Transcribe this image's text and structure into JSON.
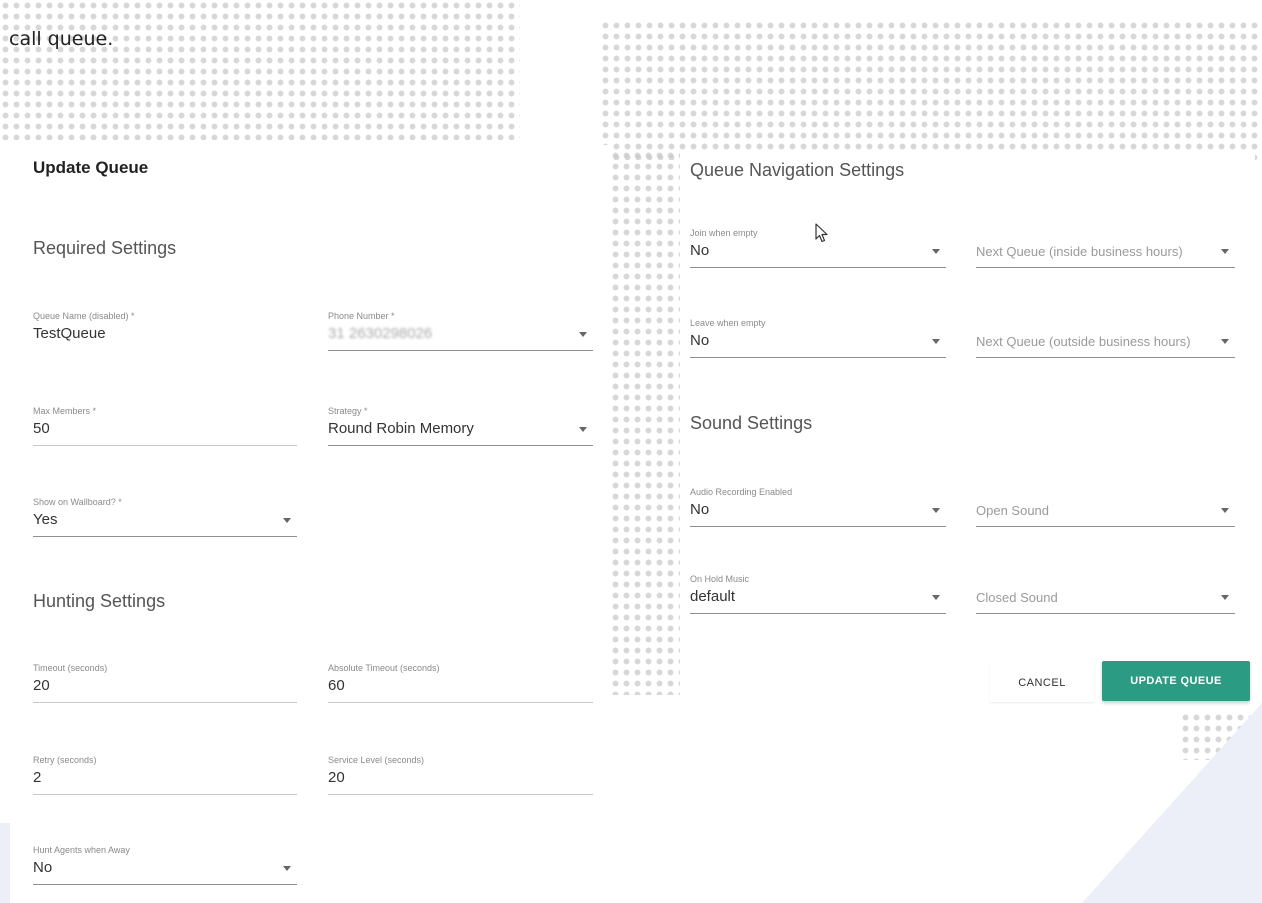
{
  "caption": {
    "text": "call queue."
  },
  "left": {
    "title": "Update Queue",
    "required_heading": "Required Settings",
    "hunting_heading": "Hunting Settings",
    "queue_name": {
      "label": "Queue Name (disabled) *",
      "value": "TestQueue"
    },
    "phone_number": {
      "label": "Phone Number *",
      "value": "31 2630298026"
    },
    "max_members": {
      "label": "Max Members *",
      "value": "50"
    },
    "strategy": {
      "label": "Strategy *",
      "value": "Round Robin Memory"
    },
    "wallboard": {
      "label": "Show on Wallboard? *",
      "value": "Yes"
    },
    "timeout": {
      "label": "Timeout (seconds)",
      "value": "20"
    },
    "absolute_timeout": {
      "label": "Absolute Timeout (seconds)",
      "value": "60"
    },
    "retry": {
      "label": "Retry (seconds)",
      "value": "2"
    },
    "service_level": {
      "label": "Service Level (seconds)",
      "value": "20"
    },
    "hunt_agents_away": {
      "label": "Hunt Agents when Away",
      "value": "No"
    }
  },
  "right": {
    "nav_heading": "Queue Navigation Settings",
    "sound_heading": "Sound Settings",
    "join_when_empty": {
      "label": "Join when empty",
      "value": "No"
    },
    "next_queue_inside": {
      "placeholder": "Next Queue (inside business hours)"
    },
    "leave_when_empty": {
      "label": "Leave when empty",
      "value": "No"
    },
    "next_queue_outside": {
      "placeholder": "Next Queue (outside business hours)"
    },
    "audio_recording": {
      "label": "Audio Recording Enabled",
      "value": "No"
    },
    "open_sound": {
      "placeholder": "Open Sound"
    },
    "on_hold_music": {
      "label": "On Hold Music",
      "value": "default"
    },
    "closed_sound": {
      "placeholder": "Closed Sound"
    },
    "cancel_label": "CANCEL",
    "update_label": "UPDATE QUEUE"
  },
  "colors": {
    "accent": "#2b9b83",
    "background_shape": "#eceef8"
  },
  "icons": {
    "dropdown": "caret-down-icon",
    "cursor": "mouse-pointer-icon"
  }
}
